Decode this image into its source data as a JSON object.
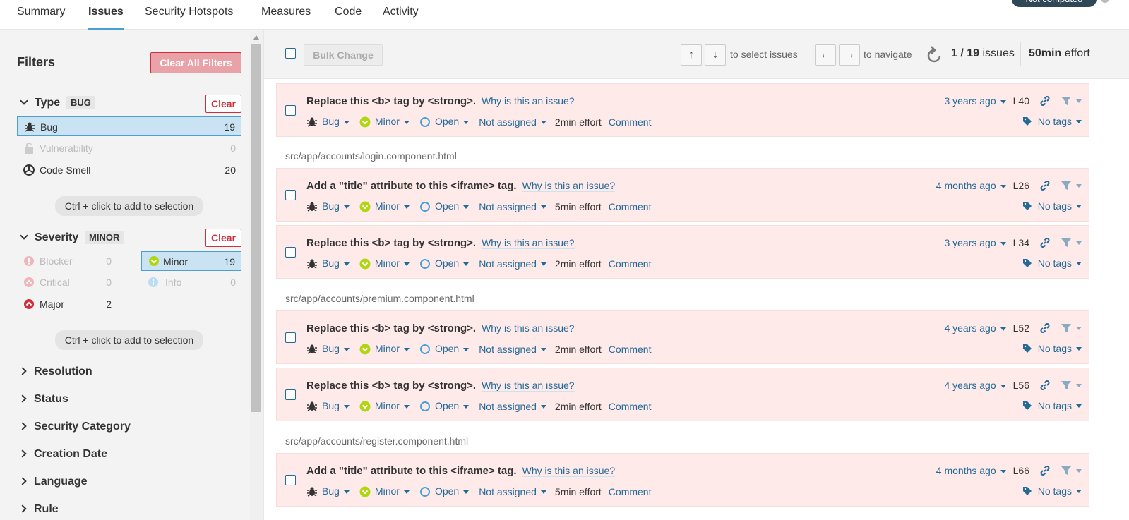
{
  "nav": {
    "tabs": [
      "Summary",
      "Issues",
      "Security Hotspots",
      "Measures",
      "Code",
      "Activity"
    ],
    "quality_gate": "Not computed"
  },
  "filters": {
    "title": "Filters",
    "clear_all": "Clear All Filters",
    "clear": "Clear",
    "hint": "Ctrl + click to add to selection",
    "type": {
      "label": "Type",
      "badge": "BUG",
      "items": [
        {
          "label": "Bug",
          "count": "19"
        },
        {
          "label": "Vulnerability",
          "count": "0"
        },
        {
          "label": "Code Smell",
          "count": "20"
        }
      ]
    },
    "severity": {
      "label": "Severity",
      "badge": "MINOR",
      "items": [
        {
          "label": "Blocker",
          "count": "0"
        },
        {
          "label": "Minor",
          "count": "19"
        },
        {
          "label": "Critical",
          "count": "0"
        },
        {
          "label": "Info",
          "count": "0"
        },
        {
          "label": "Major",
          "count": "2"
        }
      ]
    },
    "collapsed": [
      "Resolution",
      "Status",
      "Security Category",
      "Creation Date",
      "Language",
      "Rule"
    ]
  },
  "toolbar": {
    "bulk": "Bulk Change",
    "select_hint": "to select issues",
    "nav_hint": "to navigate",
    "counter": "1 / 19",
    "counter_suffix": "issues",
    "effort": "50min",
    "effort_suffix": "effort",
    "keys": [
      "↑",
      "↓",
      "←",
      "→"
    ]
  },
  "issues": [
    {
      "msg": "Replace this <b> tag by <strong>.",
      "why": "Why is this an issue?",
      "type": "Bug",
      "severity": "Minor",
      "status": "Open",
      "assignee": "Not assigned",
      "effort": "2min effort",
      "comment": "Comment",
      "age": "3 years ago",
      "line": "L40",
      "tags": "No tags"
    },
    {
      "path": "src/app/accounts/login.component.html",
      "msg": "Add a \"title\" attribute to this <iframe> tag.",
      "why": "Why is this an issue?",
      "type": "Bug",
      "severity": "Minor",
      "status": "Open",
      "assignee": "Not assigned",
      "effort": "5min effort",
      "comment": "Comment",
      "age": "4 months ago",
      "line": "L26",
      "tags": "No tags"
    },
    {
      "msg": "Replace this <b> tag by <strong>.",
      "why": "Why is this an issue?",
      "type": "Bug",
      "severity": "Minor",
      "status": "Open",
      "assignee": "Not assigned",
      "effort": "2min effort",
      "comment": "Comment",
      "age": "3 years ago",
      "line": "L34",
      "tags": "No tags"
    },
    {
      "path": "src/app/accounts/premium.component.html",
      "msg": "Replace this <b> tag by <strong>.",
      "why": "Why is this an issue?",
      "type": "Bug",
      "severity": "Minor",
      "status": "Open",
      "assignee": "Not assigned",
      "effort": "2min effort",
      "comment": "Comment",
      "age": "4 years ago",
      "line": "L52",
      "tags": "No tags"
    },
    {
      "msg": "Replace this <b> tag by <strong>.",
      "why": "Why is this an issue?",
      "type": "Bug",
      "severity": "Minor",
      "status": "Open",
      "assignee": "Not assigned",
      "effort": "2min effort",
      "comment": "Comment",
      "age": "4 years ago",
      "line": "L56",
      "tags": "No tags"
    },
    {
      "path": "src/app/accounts/register.component.html",
      "msg": "Add a \"title\" attribute to this <iframe> tag.",
      "why": "Why is this an issue?",
      "type": "Bug",
      "severity": "Minor",
      "status": "Open",
      "assignee": "Not assigned",
      "effort": "5min effort",
      "comment": "Comment",
      "age": "4 months ago",
      "line": "L66",
      "tags": "No tags"
    }
  ]
}
